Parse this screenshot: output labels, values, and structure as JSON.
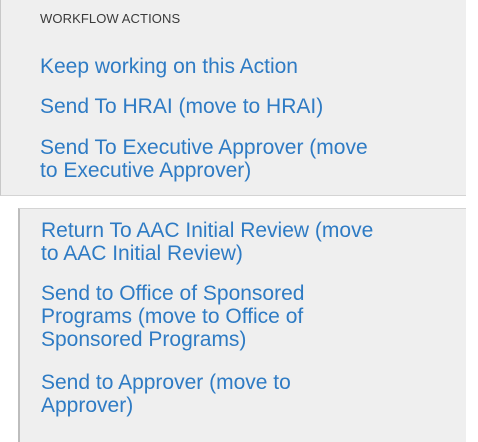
{
  "workflow": {
    "title": "WORKFLOW ACTIONS",
    "actions": [
      "Keep working on this Action",
      "Send To HRAI (move to HRAI)",
      "Send To Executive Approver (move\nto Executive Approver)",
      "Return To AAC Initial Review (move\nto AAC Initial Review)",
      "Send to Office of Sponsored\nPrograms (move to Office of\nSponsored Programs)",
      "Send to Approver (move to\nApprover)"
    ]
  },
  "colors": {
    "link": "#2e7bc4",
    "panel_background": "#efefef",
    "header_text": "#3a3a3a"
  }
}
